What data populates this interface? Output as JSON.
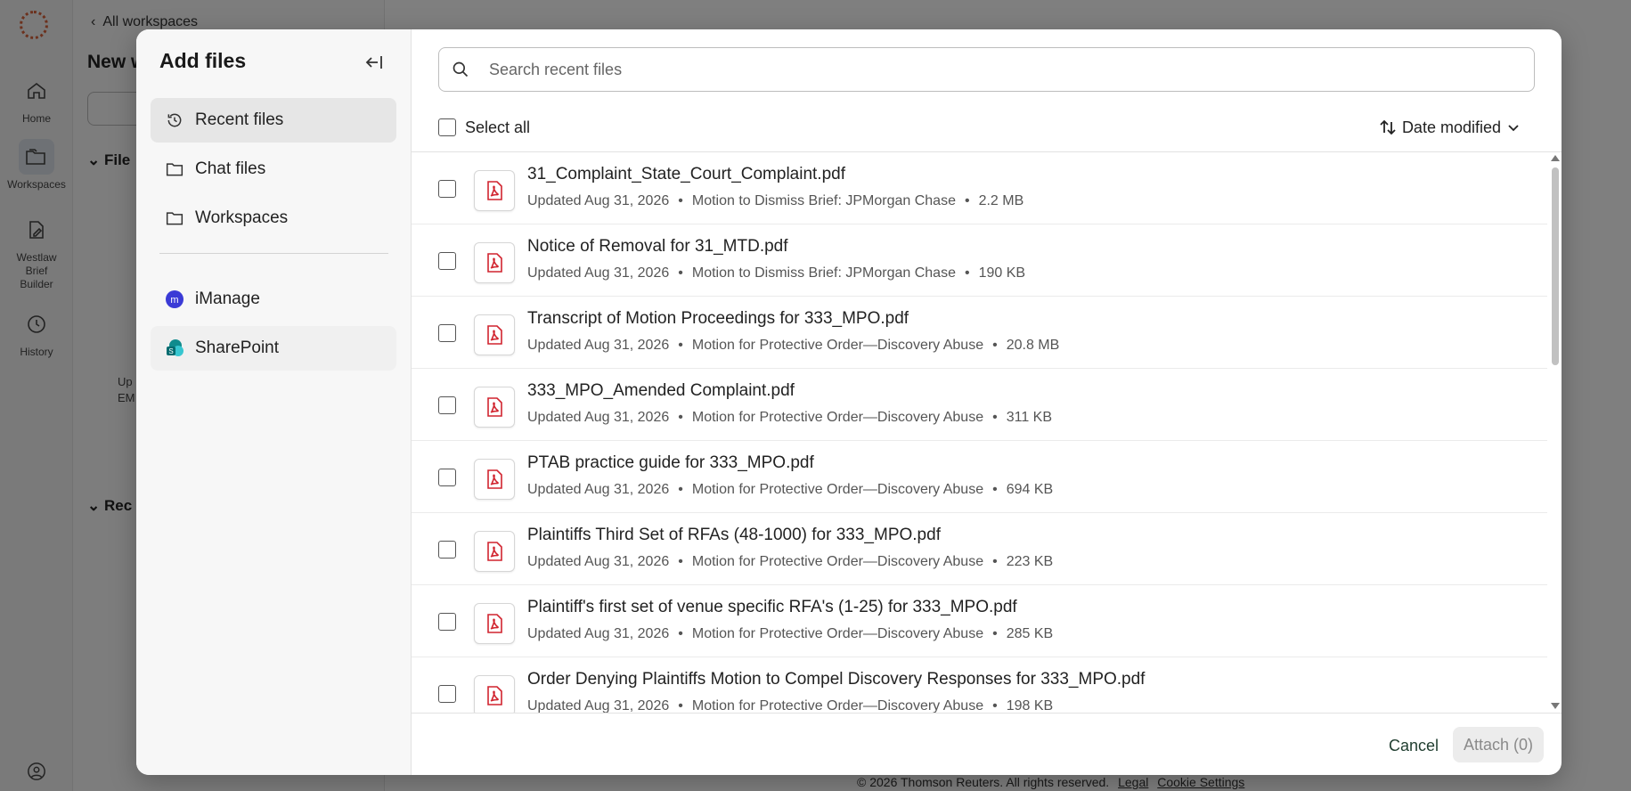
{
  "background": {
    "back_link": "All workspaces",
    "title": "New w",
    "search_placeholder": "S",
    "section_files": "File",
    "section_recent": "Rec",
    "file_snippet_1": "Up",
    "file_snippet_2": "EM",
    "rail": [
      {
        "label": "Home",
        "icon": "home-icon"
      },
      {
        "label": "Workspaces",
        "icon": "folders-icon"
      },
      {
        "label": "Westlaw Brief Builder",
        "icon": "document-edit-icon"
      },
      {
        "label": "History",
        "icon": "history-icon"
      }
    ],
    "footer": {
      "copyright": "© 2026 Thomson Reuters. All rights reserved.",
      "legal": "Legal",
      "cookies": "Cookie Settings"
    }
  },
  "modal": {
    "title": "Add files",
    "nav": [
      {
        "label": "Recent files",
        "icon": "history-icon",
        "selected": true
      },
      {
        "label": "Chat files",
        "icon": "folder-icon"
      },
      {
        "label": "Workspaces",
        "icon": "folder-icon"
      }
    ],
    "integrations": [
      {
        "label": "iManage",
        "icon": "imanage-icon",
        "color": "#3b3bd6"
      },
      {
        "label": "SharePoint",
        "icon": "sharepoint-icon",
        "color": "#0f8b8d"
      }
    ],
    "search": {
      "placeholder": "Search recent files"
    },
    "select_all": "Select all",
    "sort_label": "Date modified",
    "files": [
      {
        "name": "31_Complaint_State_Court_Complaint.pdf",
        "updated": "Updated Aug 31, 2026",
        "source": "Motion to Dismiss Brief: JPMorgan Chase",
        "size": "2.2 MB"
      },
      {
        "name": "Notice of Removal for 31_MTD.pdf",
        "updated": "Updated Aug 31, 2026",
        "source": "Motion to Dismiss Brief: JPMorgan Chase",
        "size": "190 KB"
      },
      {
        "name": "Transcript of Motion Proceedings for 333_MPO.pdf",
        "updated": "Updated Aug 31, 2026",
        "source": "Motion for Protective Order—Discovery Abuse",
        "size": "20.8 MB"
      },
      {
        "name": "333_MPO_Amended Complaint.pdf",
        "updated": "Updated Aug 31, 2026",
        "source": "Motion for Protective Order—Discovery Abuse",
        "size": "311 KB"
      },
      {
        "name": "PTAB practice guide for 333_MPO.pdf",
        "updated": "Updated Aug 31, 2026",
        "source": "Motion for Protective Order—Discovery Abuse",
        "size": "694 KB"
      },
      {
        "name": "Plaintiffs Third Set of RFAs (48-1000) for 333_MPO.pdf",
        "updated": "Updated Aug 31, 2026",
        "source": "Motion for Protective Order—Discovery Abuse",
        "size": "223 KB"
      },
      {
        "name": "Plaintiff's first set of venue specific RFA's (1-25) for 333_MPO.pdf",
        "updated": "Updated Aug 31, 2026",
        "source": "Motion for Protective Order—Discovery Abuse",
        "size": "285 KB"
      },
      {
        "name": "Order Denying Plaintiffs Motion to Compel Discovery Responses for 333_MPO.pdf",
        "updated": "Updated Aug 31, 2026",
        "source": "Motion for Protective Order—Discovery Abuse",
        "size": "198 KB"
      }
    ],
    "meta_separator": "•",
    "cancel_label": "Cancel",
    "attach_label": "Attach (0)",
    "colors": {
      "pdf_red": "#d1242f",
      "accent_green": "#1f3d2f"
    }
  }
}
